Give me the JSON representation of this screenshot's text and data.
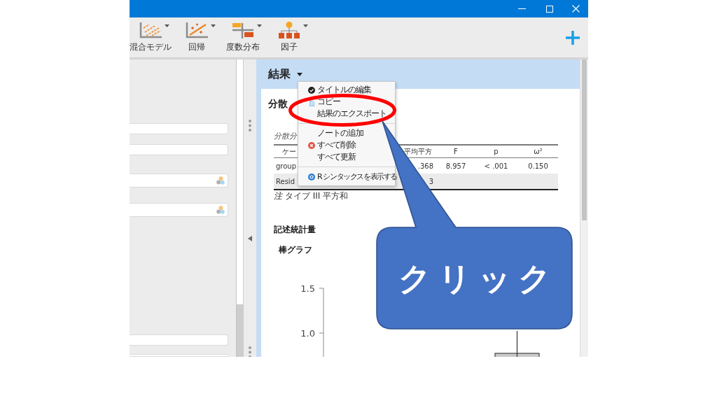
{
  "toolbar": {
    "items": [
      {
        "label": "混合モデル",
        "kind": "mixed",
        "dropdown": true
      },
      {
        "label": "回帰",
        "kind": "regression",
        "dropdown": true
      },
      {
        "label": "度数分布",
        "kind": "frequencies",
        "dropdown": true
      },
      {
        "label": "因子",
        "kind": "factor",
        "dropdown": true
      }
    ]
  },
  "options_panel": {
    "sections": [
      {
        "fields": [
          {
            "kind": "text"
          },
          {
            "kind": "text"
          }
        ]
      },
      {
        "fields": [
          {
            "kind": "variable"
          },
          {
            "kind": "variable"
          }
        ]
      },
      {
        "fields": [
          {
            "kind": "text"
          },
          {
            "kind": "text"
          }
        ]
      }
    ]
  },
  "results": {
    "title": "結果",
    "heading": "分散",
    "table": {
      "caption": "分散分",
      "columns": [
        "ケー",
        "平均平方",
        "F",
        "p",
        "ω²"
      ],
      "rows": [
        {
          "cells": [
            "group",
            ".368",
            "8.957",
            "< .001",
            "0.150"
          ],
          "highlighted": false
        },
        {
          "cells": [
            "Resid",
            "3"
          ],
          "highlighted": true
        }
      ],
      "note": "*注* タイプ III 平方和"
    },
    "descriptives": {
      "heading": "記述統計量",
      "plot_title": "棒グラフ",
      "plot": {
        "y_ticks": [
          "1.5",
          "1.0"
        ]
      }
    }
  },
  "context_menu": {
    "sections": [
      {
        "items": [
          {
            "label": "タイトルの編集",
            "kind": "edit"
          },
          {
            "label": "コピー",
            "kind": "copy"
          },
          {
            "label": "結果のエクスポート",
            "kind": "export"
          }
        ]
      },
      {
        "items": [
          {
            "label": "ノートの追加",
            "kind": "note"
          },
          {
            "label": "すべて削除",
            "kind": "delete"
          },
          {
            "label": "すべて更新",
            "kind": "refresh"
          }
        ]
      },
      {
        "items": [
          {
            "label": "R シンタックスを表示する",
            "kind": "syntax"
          }
        ]
      }
    ]
  },
  "callout": {
    "text": "クリック"
  }
}
